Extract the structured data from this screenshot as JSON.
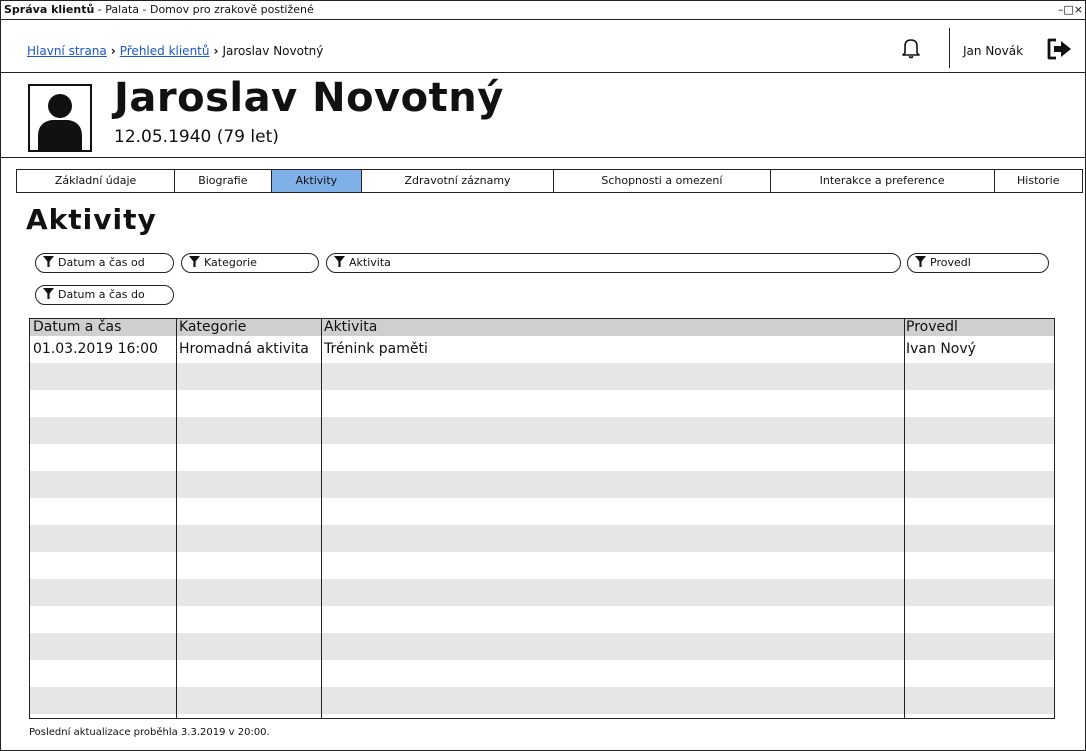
{
  "window": {
    "title_bold": "Správa klientů",
    "title_rest": " - Palata - Domov pro zrakově postižené",
    "controls": "–□×"
  },
  "breadcrumb": {
    "home": "Hlavní strana",
    "clients": "Přehled klientů",
    "current": "Jaroslav Novotný"
  },
  "user": {
    "name": "Jan Novák"
  },
  "client": {
    "name": "Jaroslav Novotný",
    "dob": "12.05.1940 (79 let)"
  },
  "tabs": [
    {
      "label": "Základní údaje",
      "active": false
    },
    {
      "label": "Biografie",
      "active": false
    },
    {
      "label": "Aktivity",
      "active": true
    },
    {
      "label": "Zdravotní záznamy",
      "active": false
    },
    {
      "label": "Schopnosti a omezení",
      "active": false
    },
    {
      "label": "Interakce a preference",
      "active": false
    },
    {
      "label": "Historie",
      "active": false
    }
  ],
  "section_title": "Aktivity",
  "filters": {
    "date_from": "Datum a čas od",
    "category": "Kategorie",
    "activity": "Aktivita",
    "performed_by": "Provedl",
    "date_to": "Datum a čas do"
  },
  "table": {
    "columns": [
      "Datum a čas",
      "Kategorie",
      "Aktivita",
      "Provedl"
    ],
    "rows": [
      [
        "01.03.2019 16:00",
        "Hromadná aktivita",
        "Trénink paměti",
        "Ivan Nový"
      ]
    ]
  },
  "footer": "Poslední aktualizace proběhla 3.3.2019 v 20:00.",
  "colors": {
    "active_tab": "#7fb0e8",
    "link": "#1a57c8",
    "header_row": "#cfcfcf",
    "stripe": "#e6e6e6"
  }
}
